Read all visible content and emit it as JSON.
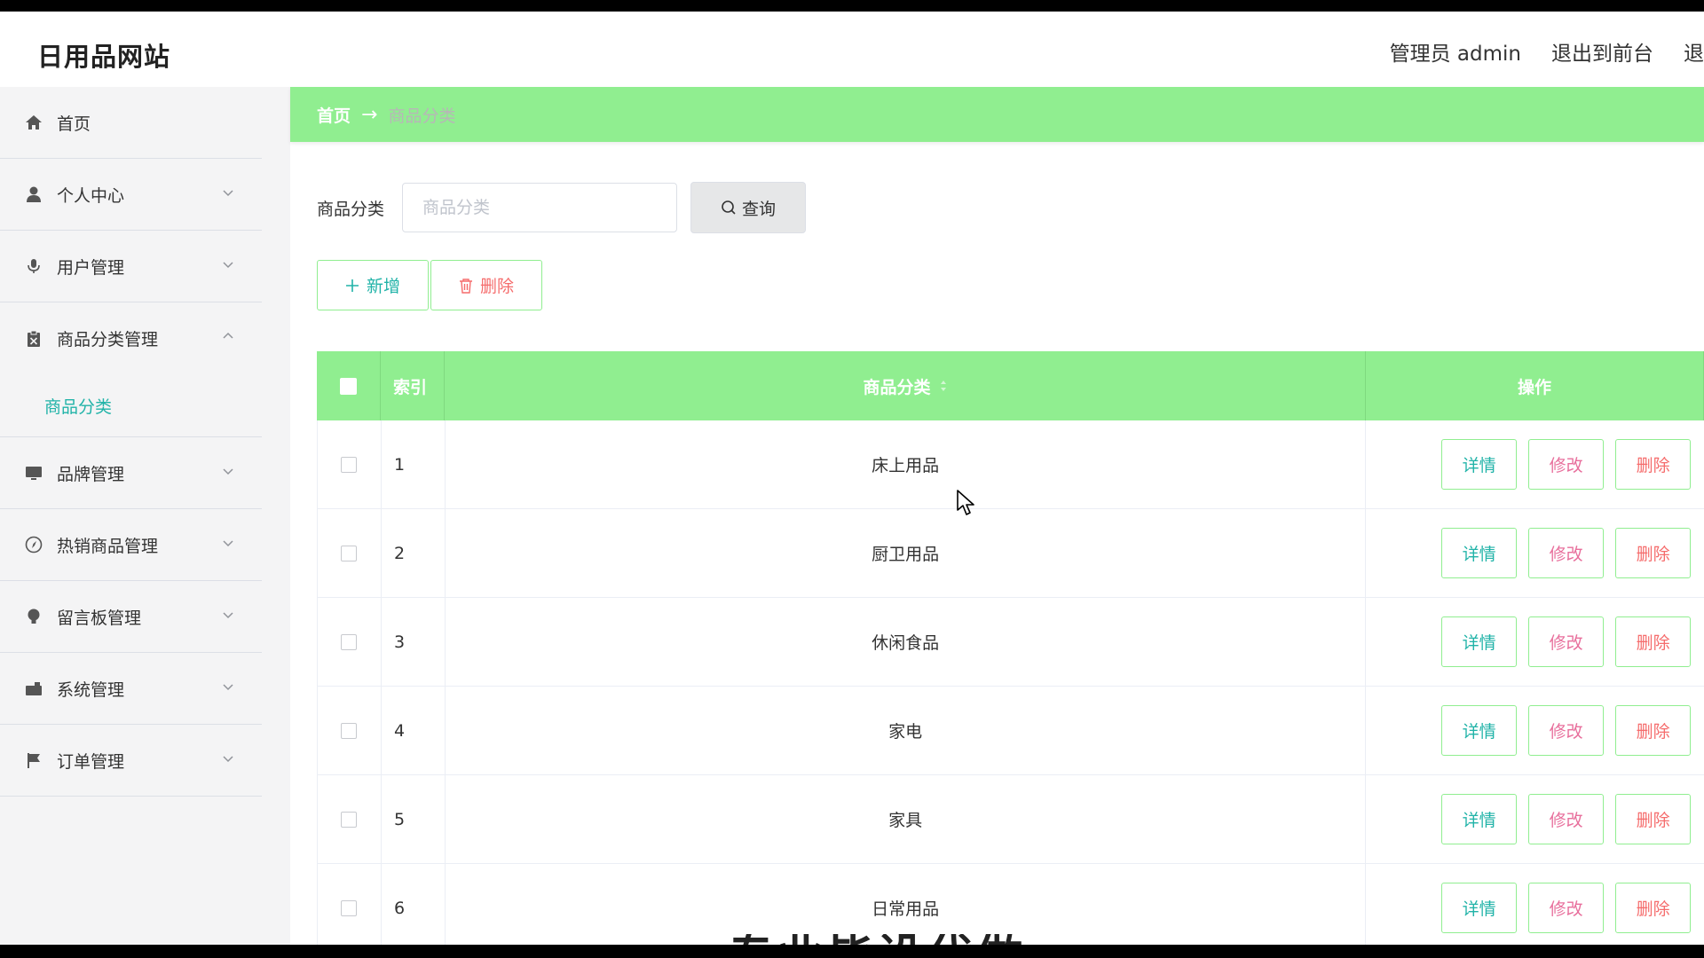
{
  "site_title": "日用品网站",
  "header": {
    "user": "管理员 admin",
    "front_link": "退出到前台",
    "logout": "退"
  },
  "sidebar": {
    "items": [
      {
        "label": "首页",
        "icon": "home-icon"
      },
      {
        "label": "个人中心",
        "icon": "user-icon"
      },
      {
        "label": "用户管理",
        "icon": "microphone-icon"
      },
      {
        "label": "商品分类管理",
        "icon": "clipboard-icon",
        "expanded": true,
        "children": [
          "商品分类"
        ]
      },
      {
        "label": "品牌管理",
        "icon": "monitor-icon"
      },
      {
        "label": "热销商品管理",
        "icon": "compass-icon"
      },
      {
        "label": "留言板管理",
        "icon": "bulb-icon"
      },
      {
        "label": "系统管理",
        "icon": "briefcase-icon"
      },
      {
        "label": "订单管理",
        "icon": "flag-icon"
      }
    ]
  },
  "breadcrumb": {
    "home": "首页",
    "separator": "→",
    "current": "商品分类"
  },
  "search": {
    "label": "商品分类",
    "placeholder": "商品分类",
    "button": "查询"
  },
  "actions": {
    "add": "新增",
    "delete": "删除"
  },
  "table": {
    "headers": {
      "index": "索引",
      "name": "商品分类",
      "ops": "操作"
    },
    "rows": [
      {
        "index": "1",
        "name": "床上用品"
      },
      {
        "index": "2",
        "name": "厨卫用品"
      },
      {
        "index": "3",
        "name": "休闲食品"
      },
      {
        "index": "4",
        "name": "家电"
      },
      {
        "index": "5",
        "name": "家具"
      },
      {
        "index": "6",
        "name": "日常用品"
      }
    ],
    "row_ops": {
      "detail": "详情",
      "edit": "修改",
      "delete": "删除"
    }
  },
  "overlay_caption": "专业毕设代做",
  "colors": {
    "accent": "#90ee90",
    "teal": "#21b3a8",
    "danger": "#f56c6c",
    "pink": "#e86f9c"
  }
}
